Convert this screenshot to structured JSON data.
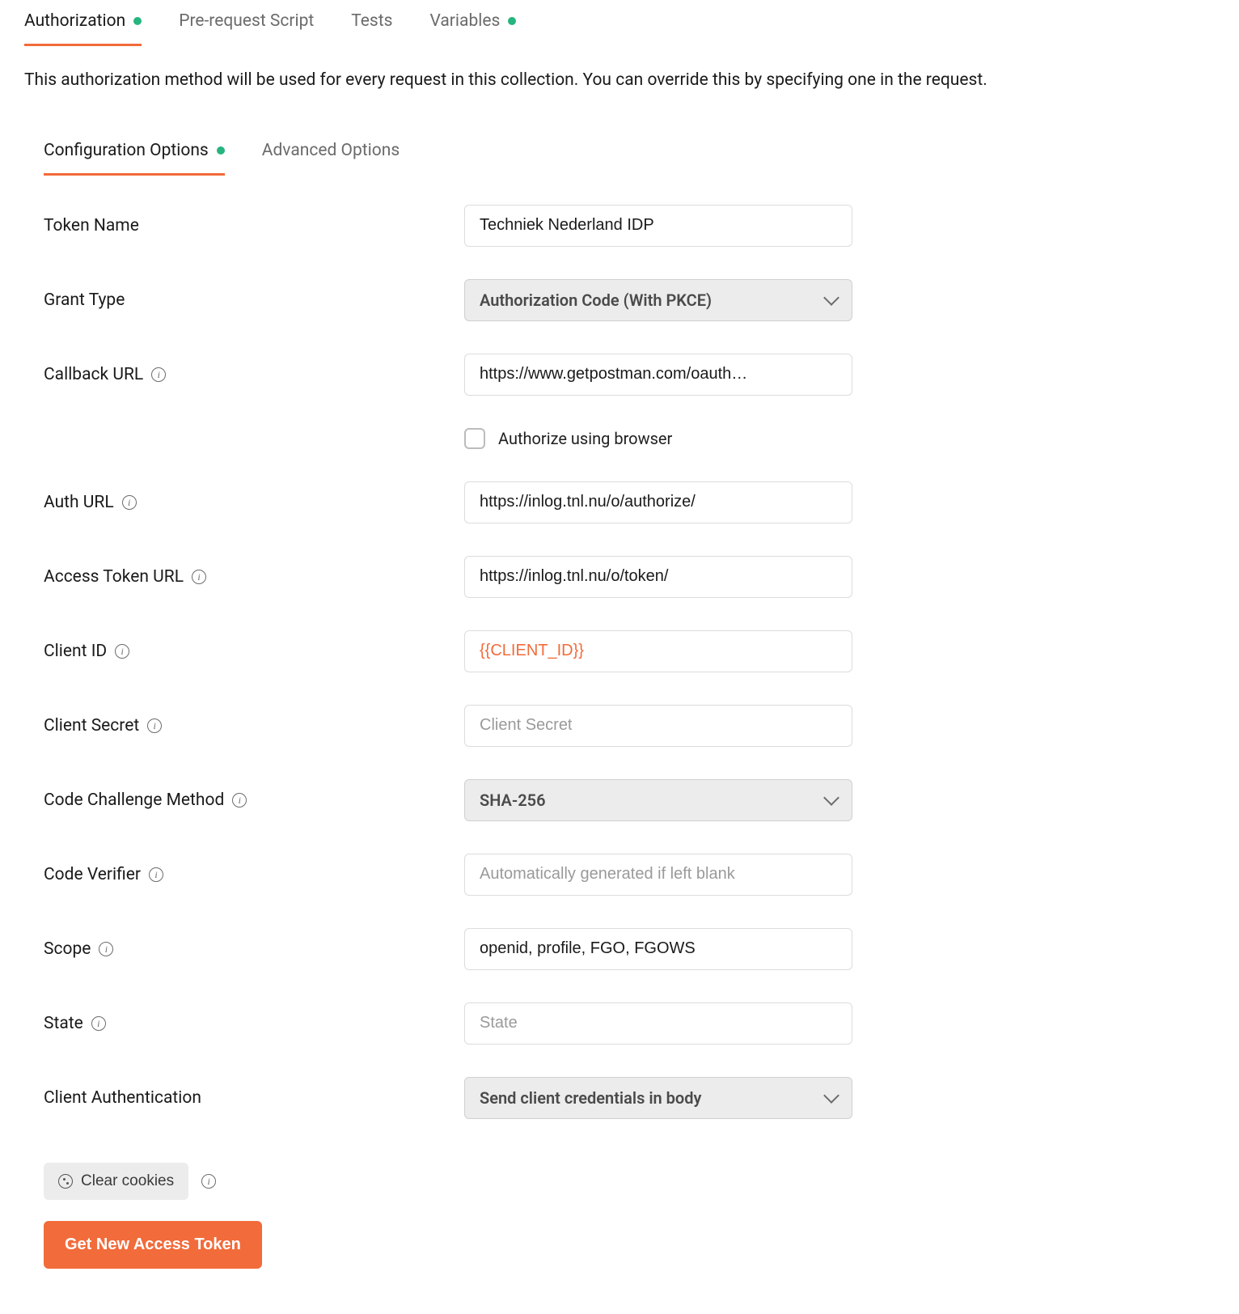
{
  "tabs": {
    "authorization": "Authorization",
    "prerequest": "Pre-request Script",
    "tests": "Tests",
    "variables": "Variables"
  },
  "description": "This authorization method will be used for every request in this collection. You can override this by specifying one in the request.",
  "subTabs": {
    "configuration": "Configuration Options",
    "advanced": "Advanced Options"
  },
  "form": {
    "tokenName": {
      "label": "Token Name",
      "value": "Techniek Nederland IDP"
    },
    "grantType": {
      "label": "Grant Type",
      "value": "Authorization Code (With PKCE)"
    },
    "callbackUrl": {
      "label": "Callback URL",
      "value": "https://www.getpostman.com/oauth…"
    },
    "authorizeBrowser": {
      "label": "Authorize using browser"
    },
    "authUrl": {
      "label": "Auth URL",
      "value": "https://inlog.tnl.nu/o/authorize/"
    },
    "accessTokenUrl": {
      "label": "Access Token URL",
      "value": "https://inlog.tnl.nu/o/token/"
    },
    "clientId": {
      "label": "Client ID",
      "value": "{{CLIENT_ID}}"
    },
    "clientSecret": {
      "label": "Client Secret",
      "placeholder": "Client Secret"
    },
    "codeChallengeMethod": {
      "label": "Code Challenge Method",
      "value": "SHA-256"
    },
    "codeVerifier": {
      "label": "Code Verifier",
      "placeholder": "Automatically generated if left blank"
    },
    "scope": {
      "label": "Scope",
      "value": "openid, profile, FGO, FGOWS"
    },
    "state": {
      "label": "State",
      "placeholder": "State"
    },
    "clientAuth": {
      "label": "Client Authentication",
      "value": "Send client credentials in body"
    }
  },
  "buttons": {
    "clearCookies": "Clear cookies",
    "getToken": "Get New Access Token"
  }
}
